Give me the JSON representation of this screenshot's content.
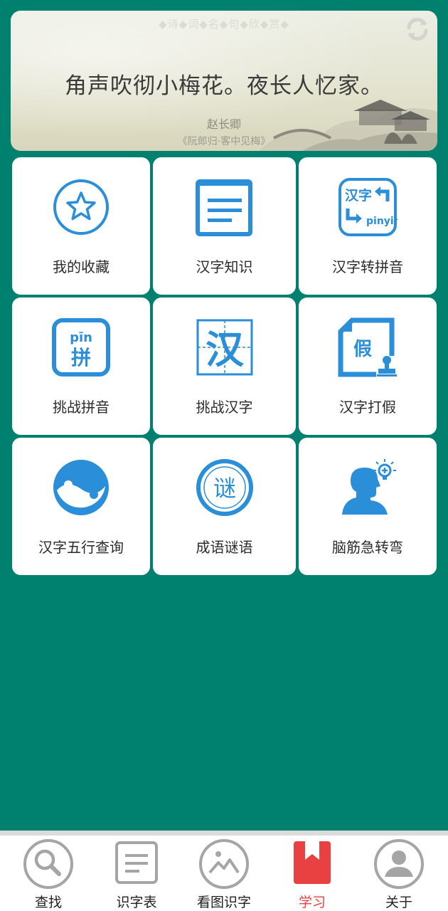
{
  "banner": {
    "header": "◆诗◆词◆名◆句◆欣◆赏◆",
    "poem_line": "角声吹彻小梅花。夜长人忆家。",
    "author": "赵长卿",
    "source": "《阮郎归·客中见梅》",
    "refresh_icon": "refresh-icon"
  },
  "tiles": [
    {
      "label": "我的收藏",
      "icon": "star-circle-icon"
    },
    {
      "label": "汉字知识",
      "icon": "document-lines-icon"
    },
    {
      "label": "汉字转拼音",
      "icon": "hanzi-to-pinyin-icon",
      "icon_text_a": "汉字",
      "icon_text_b": "pinyin"
    },
    {
      "label": "挑战拼音",
      "icon": "pinyin-challenge-icon",
      "icon_text_a": "pīn",
      "icon_text_b": "拼"
    },
    {
      "label": "挑战汉字",
      "icon": "hanzi-challenge-icon",
      "icon_text_a": "汉"
    },
    {
      "label": "汉字打假",
      "icon": "fake-stamp-icon",
      "icon_text_a": "假"
    },
    {
      "label": "汉字五行查询",
      "icon": "yin-yang-icon"
    },
    {
      "label": "成语谜语",
      "icon": "seal-riddle-icon",
      "icon_text_a": "谜"
    },
    {
      "label": "脑筋急转弯",
      "icon": "head-idea-icon"
    }
  ],
  "nav": [
    {
      "label": "查找",
      "icon": "search-icon",
      "active": false
    },
    {
      "label": "识字表",
      "icon": "list-icon",
      "active": false
    },
    {
      "label": "看图识字",
      "icon": "image-icon",
      "active": false
    },
    {
      "label": "学习",
      "icon": "bookmark-book-icon",
      "active": true
    },
    {
      "label": "关于",
      "icon": "user-icon",
      "active": false
    }
  ],
  "colors": {
    "background": "#00816f",
    "icon_blue": "#2a8ed8",
    "active_red": "#e94141",
    "nav_gray": "#a5a5a5"
  }
}
